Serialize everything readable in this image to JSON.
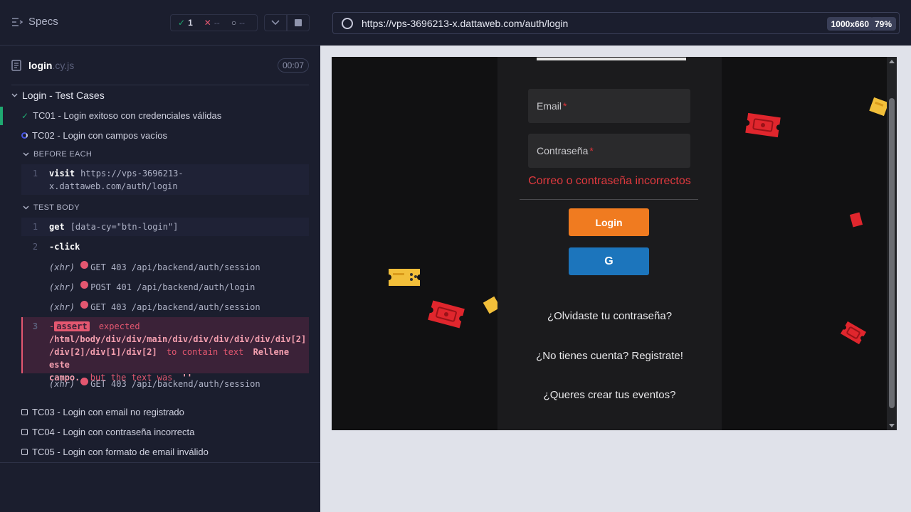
{
  "reporter": {
    "header": {
      "title": "Specs",
      "passed_count": "1",
      "failed_count": "--",
      "pending_count": "--"
    },
    "spec": {
      "name": "login",
      "ext": ".cy.js",
      "duration": "00:07"
    },
    "suite": {
      "title": "Login - Test Cases"
    },
    "tests": [
      {
        "label": "TC01 - Login exitoso con credenciales válidas",
        "state": "passed"
      },
      {
        "label": "TC02 - Login con campos vacíos",
        "state": "running"
      },
      {
        "label": "TC03 - Login con email no registrado",
        "state": "pending"
      },
      {
        "label": "TC04 - Login con contraseña incorrecta",
        "state": "pending"
      },
      {
        "label": "TC05 - Login con formato de email inválido",
        "state": "pending"
      }
    ],
    "sections": {
      "before_each": "BEFORE EACH",
      "test_body": "TEST BODY"
    },
    "before_each_cmd": {
      "num": "1",
      "name": "visit",
      "msg_line1": "https://vps-3696213-",
      "msg_line2": "x.dattaweb.com/auth/login"
    },
    "body_cmds": [
      {
        "num": "1",
        "name": "get",
        "msg": "[data-cy=\"btn-login\"]"
      },
      {
        "num": "2",
        "name": "-click",
        "msg": ""
      }
    ],
    "xhr": [
      {
        "tag": "(xhr)",
        "text": "GET 403 /api/backend/auth/session"
      },
      {
        "tag": "(xhr)",
        "text": "POST 401 /api/backend/auth/login"
      },
      {
        "tag": "(xhr)",
        "text": "GET 403 /api/backend/auth/session"
      },
      {
        "tag": "(xhr)",
        "text": "GET 403 /api/backend/auth/session"
      }
    ],
    "assert": {
      "num": "3",
      "dash": "-",
      "tag": "assert",
      "expected": "expected",
      "xpath_line1": "/html/body/div/div/main/div/div/div/div/div/div[2]",
      "xpath_line2": "/div[2]/div[1]/div[2]",
      "contain": "to contain text",
      "text1": "Rellene este",
      "text2": "campo.",
      "but": ", but the text was",
      "actual": "''"
    }
  },
  "aut": {
    "url": "https://vps-3696213-x.dattaweb.com/auth/login",
    "viewport": "1000x660",
    "scale": "79%",
    "app": {
      "email_placeholder": "Email",
      "password_placeholder": "Contraseña",
      "required_mark": "*",
      "error": "Correo o contraseña incorrectos",
      "login_button": "Login",
      "google_button": "G",
      "forgot_link": "¿Olvidaste tu contraseña?",
      "register_link": "¿No tienes cuenta? Registrate!",
      "events_link": "¿Queres crear tus eventos?"
    }
  },
  "colors": {
    "passed": "#1fa971",
    "failed": "#e45770",
    "login_orange": "#f07b20",
    "google_blue": "#1c75bc",
    "ticket_red": "#e0262d",
    "ticket_yellow": "#f2bf3a"
  },
  "icons": [
    "list-icon",
    "check-icon",
    "x-icon",
    "spinner-icon",
    "chevron-down-icon",
    "stop-icon",
    "file-icon",
    "globe-icon",
    "ticket-icon"
  ]
}
